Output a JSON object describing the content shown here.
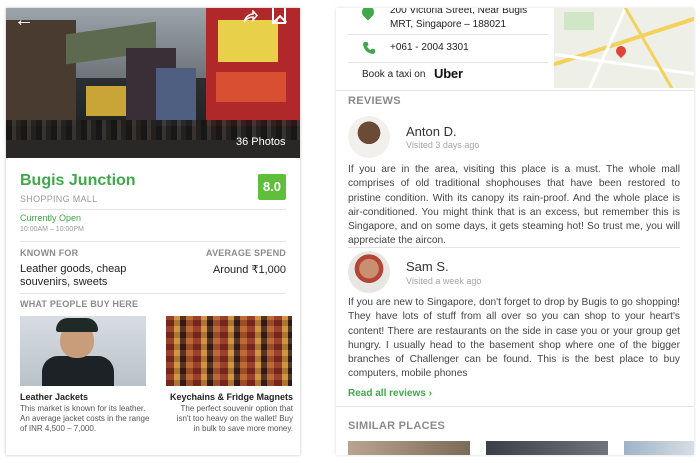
{
  "left": {
    "hero": {
      "back_icon": "←",
      "photos_label": "36 Photos"
    },
    "place": {
      "name": "Bugis Junction",
      "category": "SHOPPING MALL",
      "rating": "8.0",
      "status": "Currently Open",
      "hours": "10:00AM – 10:00PM"
    },
    "known_for": {
      "label": "KNOWN FOR",
      "value": "Leather goods, cheap souvenirs, sweets"
    },
    "average_spend": {
      "label": "AVERAGE SPEND",
      "value": "Around ₹1,000"
    },
    "buy_section": {
      "label": "WHAT PEOPLE BUY HERE",
      "items": [
        {
          "name": "Leather Jackets",
          "desc": "This market is known for its leather. An average jacket costs in the range of INR 4,500 – 7,000."
        },
        {
          "name": "Keychains & Fridge Magnets",
          "desc": "The perfect souvenir option that isn't too heavy on the wallet! Buy in bulk to save more money."
        }
      ]
    }
  },
  "right": {
    "contact": {
      "address": "200 Victoria Street, Near Bugis MRT, Singapore – 188021",
      "phone": "+061 - 2004 3301",
      "taxi_label": "Book a taxi on",
      "taxi_brand": "Uber"
    },
    "reviews": {
      "label": "REVIEWS",
      "items": [
        {
          "name": "Anton D.",
          "time": "Visited 3 days ago",
          "body": "If you are in the area, visiting this place is a must. The whole mall comprises of old traditional shophouses that have been restored to pristine condition. With its canopy its rain-proof. And the whole place is air-conditioned. You might think that is an excess, but remember this is Singapore, and on some days, it gets steaming hot! So trust me, you will appreciate the aircon."
        },
        {
          "name": "Sam S.",
          "time": "Visited a week ago",
          "body": "If you are new to Singapore, don't forget to drop by Bugis to go shopping! They have lots of stuff from all over so you can shop to your heart's content! There are restaurants on the side in case you or your group get hungry. I usually head to the basement shop where one of the bigger branches of Challenger can be found. This is the best place to buy computers, mobile phones"
        }
      ],
      "read_all": "Read all reviews  ›"
    },
    "similar": {
      "label": "SIMILAR PLACES"
    }
  },
  "colors": {
    "accent_green": "#3ea84a",
    "rating_green": "#5fbf3a",
    "muted_gray": "#8b8b8b"
  },
  "icons": {
    "back": "arrow-left-icon",
    "share": "share-icon",
    "bookmark": "bookmark-icon",
    "location": "location-pin-icon",
    "phone": "phone-icon"
  }
}
